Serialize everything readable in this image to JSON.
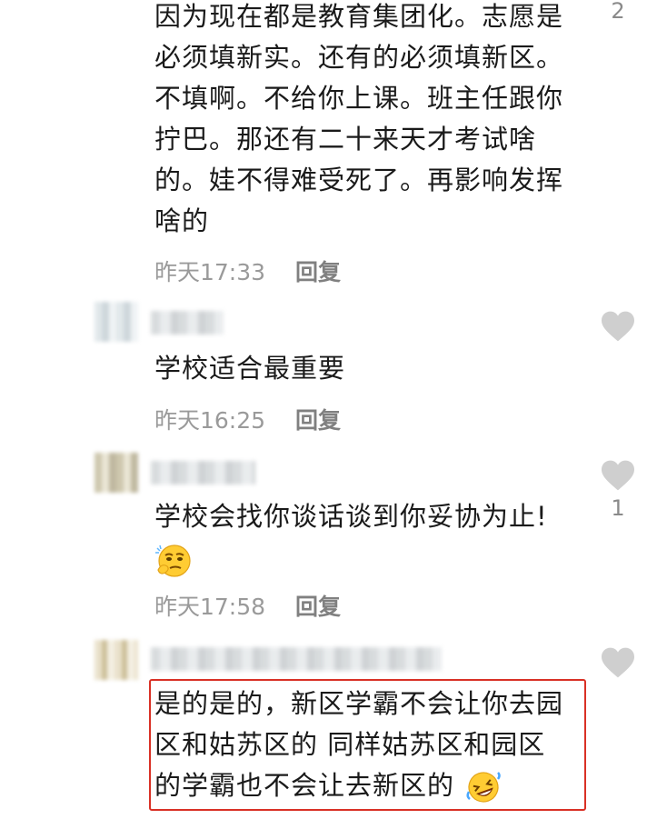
{
  "comments": [
    {
      "lines": [
        "因为现在都是教育集团化。志愿是",
        "必须填新实。还有的必须填新区。",
        "不填啊。不给你上课。班主任跟你",
        "拧巴。那还有二十来天才考试啥",
        "的。娃不得难受死了。再影响发挥",
        "啥的"
      ],
      "time": "昨天17:33",
      "reply_label": "回复",
      "like_count": "2"
    },
    {
      "lines": [
        "学校适合最重要"
      ],
      "time": "昨天16:25",
      "reply_label": "回复",
      "like_icon": "heart-icon"
    },
    {
      "lines": [
        "学校会找你谈话谈到你妥协为止!"
      ],
      "emoji": "thinking-face-emoji",
      "time": "昨天17:58",
      "reply_label": "回复",
      "like_icon": "heart-icon",
      "like_count": "1"
    },
    {
      "lines": [
        "是的是的，新区学霸不会让你去园",
        "区和姑苏区的 同样姑苏区和园区",
        "的学霸也不会让去新区的"
      ],
      "emoji": "rofl-emoji",
      "like_icon": "heart-icon",
      "highlight_color": "#d93025"
    }
  ]
}
